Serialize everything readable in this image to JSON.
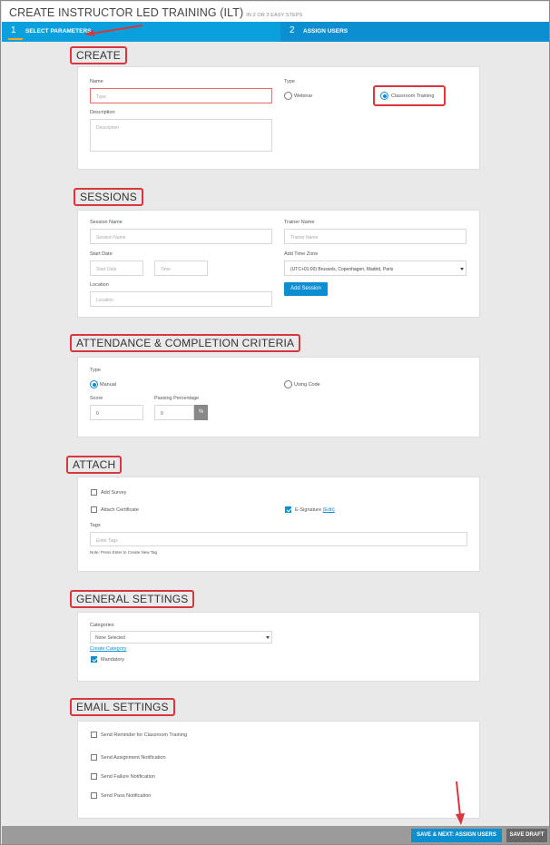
{
  "header": {
    "title": "CREATE INSTRUCTOR LED TRAINING (ILT)",
    "subtitle": "IN 2 OR 3 EASY STEPS"
  },
  "steps": [
    {
      "num": "1",
      "label": "SELECT PARAMETERS"
    },
    {
      "num": "2",
      "label": "ASSIGN USERS"
    }
  ],
  "create": {
    "title": "CREATE",
    "name_label": "Name",
    "name_placeholder": "Type",
    "description_label": "Description",
    "description_placeholder": "Description",
    "type_label": "Type",
    "type_options": [
      "Webinar",
      "Classroom Training"
    ],
    "type_selected": "Classroom Training"
  },
  "sessions": {
    "title": "SESSIONS",
    "session_name_label": "Session Name",
    "session_name_placeholder": "Session Name",
    "trainer_name_label": "Trainer Name",
    "trainer_name_placeholder": "Trainer Name",
    "start_date_label": "Start Date",
    "start_date_placeholder": "Start Date",
    "time_placeholder": "Time",
    "time_zone_label": "Add Time Zone",
    "time_zone_value": "(UTC+01:00) Brussels, Copenhagen, Madrid, Paris",
    "location_label": "Location",
    "location_placeholder": "Location",
    "add_session_label": "Add Session"
  },
  "attendance": {
    "title": "ATTENDANCE & COMPLETION CRITERIA",
    "type_label": "Type",
    "type_options": [
      "Manual",
      "Using Code"
    ],
    "type_selected": "Manual",
    "score_label": "Score",
    "score_value": "0",
    "passing_label": "Passing Percentage",
    "passing_value": "0",
    "percent_symbol": "%"
  },
  "attach": {
    "title": "ATTACH",
    "add_survey": "Add Survey",
    "attach_certificate": "Attach Certificate",
    "e_signature": "E-Signature",
    "edit_link": "(Edit)",
    "tags_label": "Tags",
    "tags_placeholder": "Enter Tags",
    "tags_note": "Note: Press Enter to Create New Tag"
  },
  "general": {
    "title": "GENERAL SETTINGS",
    "categories_label": "Categories",
    "categories_value": "None Selected",
    "create_category": "Create Category",
    "mandatory": "Mandatory"
  },
  "email": {
    "title": "EMAIL SETTINGS",
    "items": [
      "Send Reminder for Classroom Training",
      "Send Assignment Notification",
      "Send Failure Notification",
      "Send Pass Notification"
    ]
  },
  "footer": {
    "next_label": "SAVE & NEXT: ASSIGN USERS",
    "draft_label": "SAVE DRAFT"
  },
  "colors": {
    "accent": "#0b8fd0",
    "step_bar": "#0aa0dd",
    "highlight": "#d9363e",
    "footer": "#9b9b9b"
  }
}
